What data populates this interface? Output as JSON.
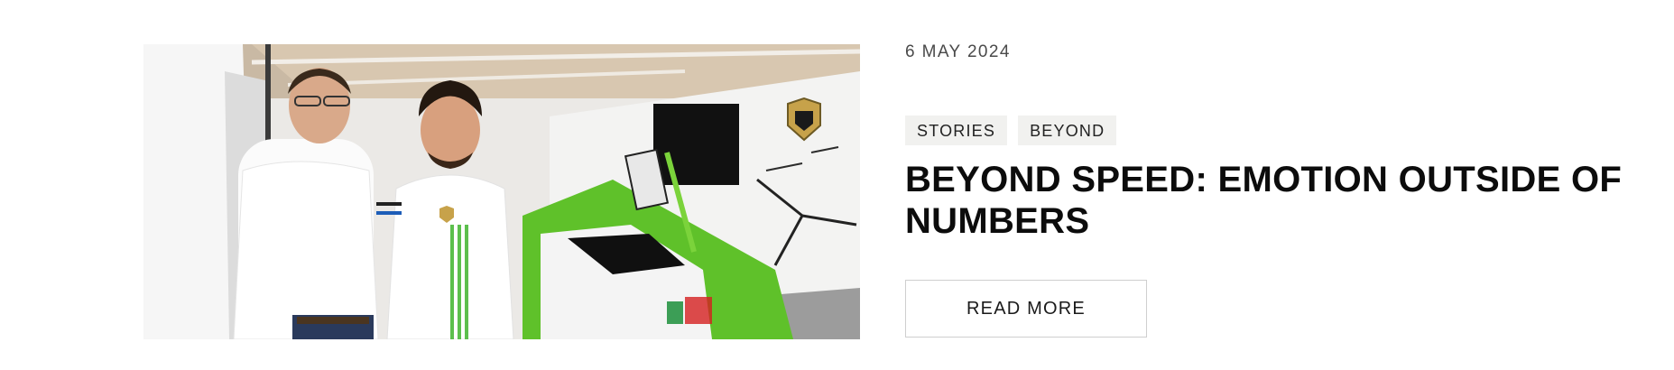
{
  "article": {
    "date": "6 MAY 2024",
    "tags": [
      "STORIES",
      "BEYOND"
    ],
    "title": "BEYOND SPEED: EMOTION OUTSIDE OF NUMBERS",
    "read_more_label": "READ MORE",
    "image": {
      "subject": "Two men in white shirts standing in a race garage beside a green and white Lamborghini race car"
    }
  },
  "colors": {
    "background": "#ffffff",
    "tag_background": "#f1f1ef",
    "title_text": "#0c0c0c",
    "button_border": "#cfcfcf",
    "car_green": "#5fc12a"
  }
}
